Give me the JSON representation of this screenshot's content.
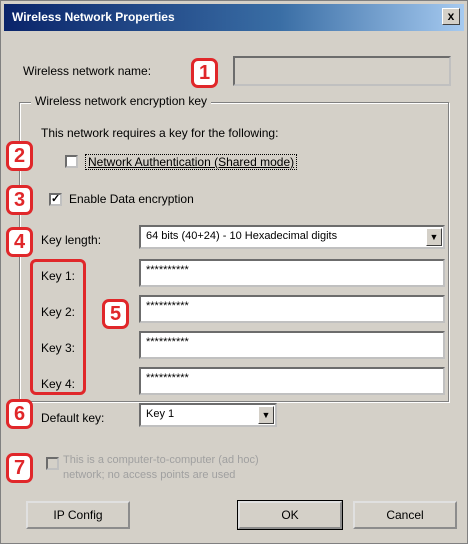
{
  "window": {
    "title": "Wireless Network Properties",
    "close_label": "x"
  },
  "network_name": {
    "label": "Wireless network name:",
    "value": ""
  },
  "encryption": {
    "group_label": "Wireless network encryption key",
    "requirement_text": "This network requires a key for the following:",
    "network_auth_label": "Network Authentication (Shared mode)",
    "network_auth_checked": false,
    "data_encryption_label": "Enable Data encryption",
    "data_encryption_checked": true,
    "key_length_label": "Key length:",
    "key_length_value": "64 bits (40+24) - 10 Hexadecimal digits",
    "keys": [
      {
        "label": "Key 1:",
        "value": "**********"
      },
      {
        "label": "Key 2:",
        "value": "**********"
      },
      {
        "label": "Key 3:",
        "value": "**********"
      },
      {
        "label": "Key 4:",
        "value": "**********"
      }
    ],
    "default_key_label": "Default key:",
    "default_key_value": "Key 1"
  },
  "adhoc": {
    "label": "This is a computer-to-computer (ad hoc) network; no access points are used",
    "checked": false
  },
  "buttons": {
    "ip_config": "IP Config",
    "ok": "OK",
    "cancel": "Cancel"
  },
  "badges": {
    "b1": "1",
    "b2": "2",
    "b3": "3",
    "b4": "4",
    "b5": "5",
    "b6": "6",
    "b7": "7"
  },
  "colors": {
    "title_bar": "#0a246a",
    "dialog_bg": "#d4d0c8",
    "badge_red": "#e0272a"
  }
}
